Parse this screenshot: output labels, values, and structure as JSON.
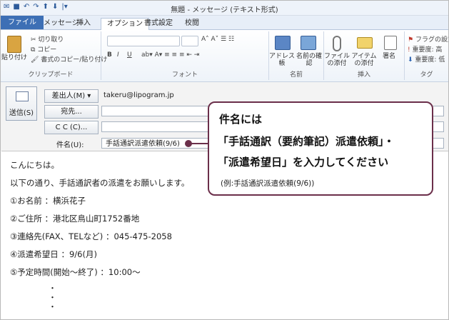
{
  "window": {
    "title": "無題 - メッセージ (テキスト形式)"
  },
  "tabs": [
    {
      "label": "ファイル"
    },
    {
      "label": "メッセージ"
    },
    {
      "label": "挿入"
    },
    {
      "label": "オプション"
    },
    {
      "label": "書式設定"
    },
    {
      "label": "校閲"
    }
  ],
  "ribbon": {
    "clipboard": {
      "paste": "貼り付け",
      "cut": "切り取り",
      "copy": "コピー",
      "format_copy": "書式のコピー/貼り付け",
      "label": "クリップボード"
    },
    "font": {
      "label": "フォント",
      "bold": "B",
      "italic": "I",
      "underline": "U"
    },
    "names": {
      "address_book": "アドレス帳",
      "check_names": "名前の確認",
      "label": "名前"
    },
    "include": {
      "attach_file": "ファイルの添付",
      "attach_item": "アイテムの添付",
      "signature": "署名",
      "label": "挿入"
    },
    "tags": {
      "followup": "フラグの設定",
      "high": "重要度: 高",
      "low": "重要度: 低",
      "label": "タグ"
    }
  },
  "header": {
    "send_label": "送信(S)",
    "from_button": "差出人(M) ▾",
    "from_value": "takeru@lipogram.jp",
    "to_button": "宛先...",
    "cc_button": "C C (C)...",
    "subject_label": "件名(U):",
    "subject_value": "手話通訳派遣依頼(9/6)"
  },
  "body": {
    "lines": [
      "こんにちは。",
      "以下の通り、手話通訳者の派遣をお願いします。",
      "①お名前 ：横浜花子",
      "②ご住所 ：港北区鳥山町1752番地",
      "③連絡先(FAX、TELなど) ：045-475-2058",
      "④派遣希望日 ：9/6(月)",
      "⑤予定時間(開始～終了) ：10:00～"
    ],
    "dots": [
      "・",
      "・",
      "・"
    ]
  },
  "callout": {
    "line1": "件名には",
    "line2": "「手話通訳（要約筆記）派遣依頼」・",
    "line3": "「派遣希望日」を入力してください",
    "line4": "(例:手話通訳派遣依頼(9/6))"
  },
  "colors": {
    "accent": "#3d6fb5",
    "callout_border": "#6b2f4a"
  }
}
